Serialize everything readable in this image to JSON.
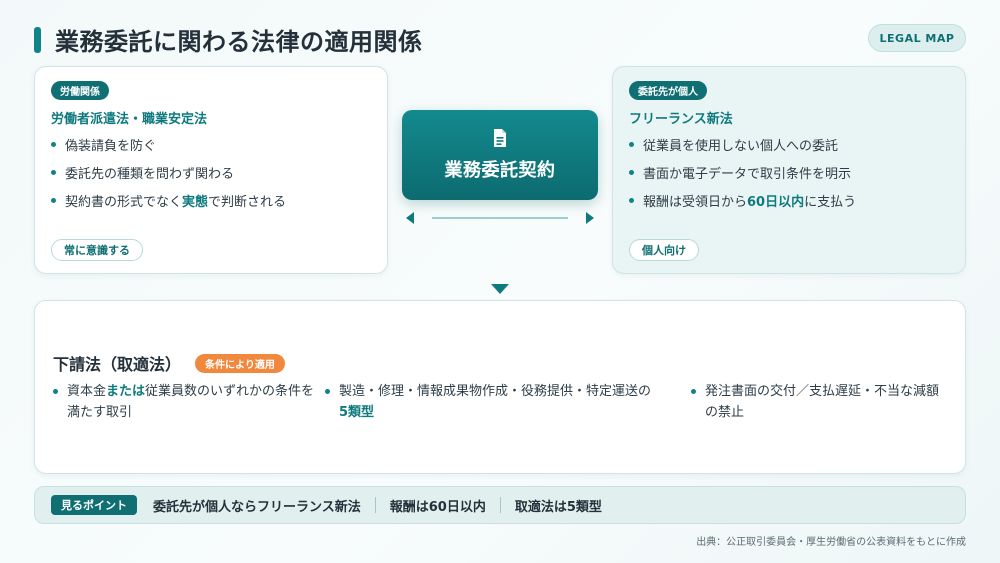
{
  "title": "業務委託に関わる法律の適用関係",
  "tag": "LEGAL MAP",
  "left_card": {
    "chip": "労働関係",
    "heading": "労働者派遣法・職業安定法",
    "bullets": [
      "偽装請負を防ぐ",
      "委託先の種類を問わず関わる"
    ],
    "bullet3_pre": "契約書の形式でなく",
    "bullet3_em": "実態",
    "bullet3_post": "で判断される",
    "pill": "常に意識する"
  },
  "center": {
    "label": "業務委託契約",
    "icon": "document-icon"
  },
  "right_card": {
    "chip": "委託先が個人",
    "heading": "フリーランス新法",
    "bullets": [
      "従業員を使用しない個人への委託",
      "書面か電子データで取引条件を明示"
    ],
    "bullet3_pre": "報酬は受領日から",
    "bullet3_em": "60日以内",
    "bullet3_post": "に支払う",
    "pill": "個人向け"
  },
  "bottom_card": {
    "heading": "下請法（取適法）",
    "chip": "条件により適用",
    "col1_pre": "資本金",
    "col1_em": "または",
    "col1_post": "従業員数のいずれかの条件を満たす取引",
    "col2_pre": "製造・修理・情報成果物作成・役務提供・特定運送の",
    "col2_em": "5類型",
    "col3": "発注書面の交付／支払遅延・不当な減額の禁止"
  },
  "strip": {
    "label": "見るポイント",
    "points": [
      "委託先が個人ならフリーランス新法",
      "報酬は60日以内",
      "取適法は5類型"
    ]
  },
  "source": "出典：公正取引委員会・厚生労働省の公表資料をもとに作成",
  "colors": {
    "teal": "#0f7a7e",
    "orange": "#f0883e"
  }
}
